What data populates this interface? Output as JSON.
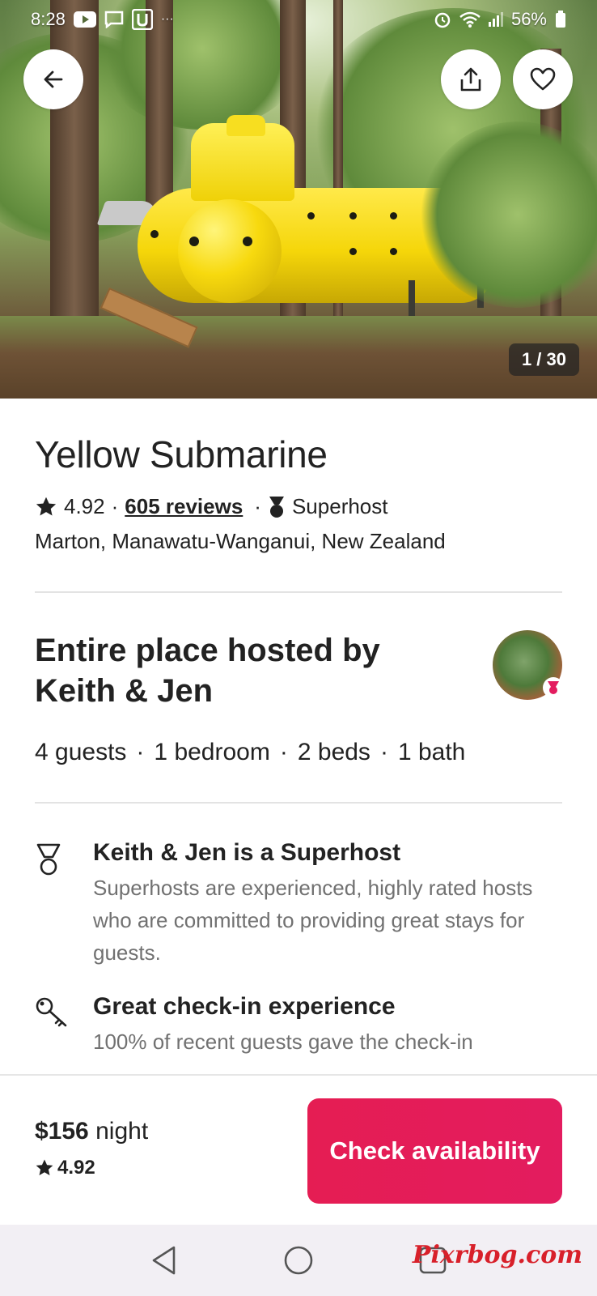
{
  "status_bar": {
    "time": "8:28",
    "battery": "56%",
    "icons": [
      "youtube-icon",
      "chat-icon",
      "app-icon",
      "more-icon",
      "alarm-icon",
      "wifi-icon",
      "signal-icon",
      "battery-icon"
    ],
    "overflow": "···"
  },
  "hero": {
    "photo_counter": "1 / 30",
    "buttons": [
      "back-arrow-icon",
      "share-icon",
      "heart-icon"
    ]
  },
  "listing": {
    "title": "Yellow Submarine",
    "rating": "4.92",
    "separator": "·",
    "reviews_link": "605 reviews",
    "superhost_label": "Superhost",
    "location": "Marton, Manawatu-Wanganui, New Zealand"
  },
  "host": {
    "title": "Entire place hosted by Keith & Jen",
    "specs": [
      "4 guests",
      "1 bedroom",
      "2 beds",
      "1 bath"
    ],
    "spec_separator": "·"
  },
  "features": [
    {
      "icon": "superhost-medal-icon",
      "title": "Keith & Jen is a Superhost",
      "description": "Superhosts are experienced, highly rated hosts who are committed to providing great stays for guests."
    },
    {
      "icon": "key-icon",
      "title": "Great check-in experience",
      "description": "100% of recent guests gave the check-in"
    }
  ],
  "booking_bar": {
    "price": "$156",
    "price_unit": "night",
    "rating": "4.92",
    "cta_label": "Check availability"
  },
  "watermark": "Pixrbog.com",
  "colors": {
    "accent": "#e31c5f",
    "text": "#222222",
    "muted": "#717171",
    "divider": "#e3e3e3"
  }
}
